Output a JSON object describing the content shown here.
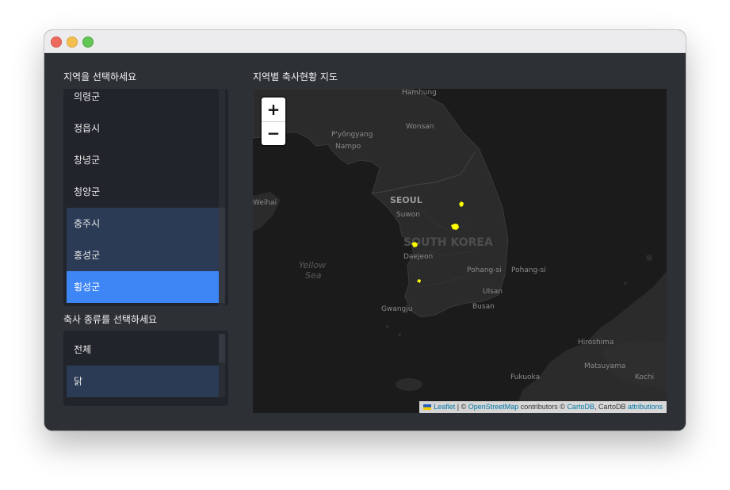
{
  "left_panel": {
    "region_label": "지역을 선택하세요",
    "region_items": [
      {
        "label": "의령군",
        "state": "normal"
      },
      {
        "label": "정읍시",
        "state": "normal"
      },
      {
        "label": "창녕군",
        "state": "normal"
      },
      {
        "label": "청양군",
        "state": "normal"
      },
      {
        "label": "충주시",
        "state": "selected"
      },
      {
        "label": "홍성군",
        "state": "selected"
      },
      {
        "label": "횡성군",
        "state": "active"
      }
    ],
    "livestock_label": "축사 종류를 선택하세요",
    "livestock_items": [
      {
        "label": "전체",
        "state": "normal"
      },
      {
        "label": "닭",
        "state": "selected"
      }
    ]
  },
  "map": {
    "title": "지역별 축사현황 지도",
    "zoom_in": "+",
    "zoom_out": "−",
    "place_labels": {
      "hamhung": "Hamhung",
      "wonsan": "Wonsan",
      "pyongyang": "P'yŏngyang",
      "nampo": "Nampo",
      "weihai": "Weihai",
      "seoul": "SEOUL",
      "suwon": "Suwon",
      "south_korea": "SOUTH KOREA",
      "daejeon": "Daejeon",
      "yellow": "Yellow",
      "sea": "Sea",
      "pohang_si_1": "Pohang-si",
      "pohang_si_2": "Pohang-si",
      "ulsan": "Ulsan",
      "busan": "Busan",
      "gwangju": "Gwangju",
      "hiroshima": "Hiroshima",
      "matsuyama": "Matsuyama",
      "fukuoka": "Fukuoka",
      "kochi": "Kochi"
    },
    "marker_color": "#ffff00",
    "attribution": {
      "leaflet": "Leaflet",
      "sep": " | © ",
      "osm": "OpenStreetMap",
      "contrib": " contributors © ",
      "cartodb": "CartoDB",
      "cartodb2": ", CartoDB ",
      "attributions": "attributions"
    }
  }
}
